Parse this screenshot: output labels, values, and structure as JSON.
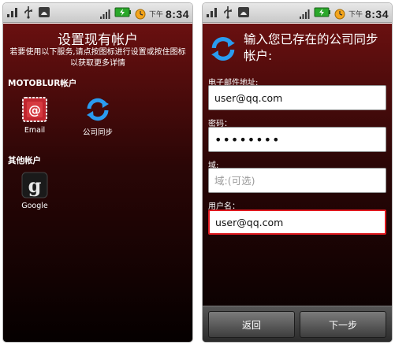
{
  "status_bar": {
    "icons_left": [
      "signal-bars-icon",
      "usb-icon",
      "android-robot-icon"
    ],
    "icons_right": [
      "cell-signal-icon",
      "battery-charging-icon",
      "alarm-clock-icon"
    ],
    "ampm": "下午",
    "time": "8:34"
  },
  "left_screen": {
    "title": "设置现有帐户",
    "subtitle": "若要使用以下服务,请点按图标进行设置或按住图标以获取更多详情",
    "section_motoblur": "MOTOBLUR帐户",
    "section_other": "其他帐户",
    "apps": {
      "email": {
        "label": "Email",
        "icon": "email-envelope-icon",
        "color": "#c0262e"
      },
      "sync": {
        "label": "公司同步",
        "icon": "sync-arrows-icon",
        "color": "#1b8ee6"
      },
      "google": {
        "label": "Google",
        "icon": "google-g-icon",
        "color": "#1a1a1a"
      }
    }
  },
  "right_screen": {
    "title": "输入您已存在的公司同步帐户:",
    "email_label": "电子邮件地址:",
    "email_value": "user@qq.com",
    "password_label": "密码：",
    "password_value": "••••••••",
    "domain_label": "域:",
    "domain_placeholder": "域:(可选)",
    "username_label": "用户名：",
    "username_value": "user@qq.com",
    "back_button": "返回",
    "next_button": "下一步"
  },
  "colors": {
    "background_top": "#6a1010",
    "background_bottom": "#050000",
    "focus_border": "#e0191f"
  }
}
